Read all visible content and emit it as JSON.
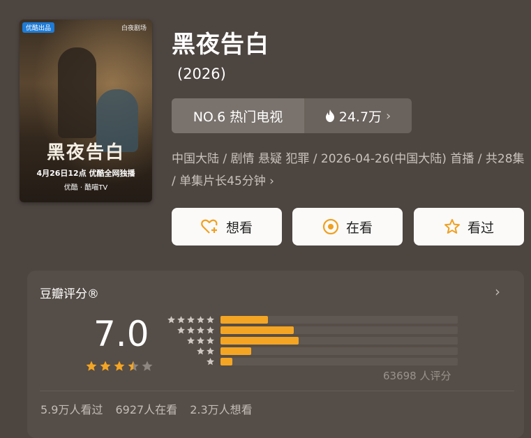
{
  "poster": {
    "badge": "优酷出品",
    "studio": "白夜剧场",
    "title": "黑夜告白",
    "date_line": "4月26日12点 优酷全网独播",
    "platform_line": "优酷 · 酷喵TV"
  },
  "header": {
    "title": "黑夜告白",
    "year": "(2026)"
  },
  "rank": {
    "label": "NO.6 热门电视",
    "heat": "24.7万",
    "heat_icon": "flame-icon",
    "chevron": "›"
  },
  "meta": {
    "text": "中国大陆 / 剧情 悬疑 犯罪 / 2026-04-26(中国大陆) 首播 / 共28集 / 单集片长45分钟 ›"
  },
  "actions": [
    {
      "label": "想看",
      "icon": "heart-plus-icon"
    },
    {
      "label": "在看",
      "icon": "target-icon"
    },
    {
      "label": "看过",
      "icon": "star-icon"
    }
  ],
  "rating": {
    "title": "豆瓣评分®",
    "chevron": "›",
    "score": "7.0",
    "star_fill": 3.5,
    "star_max": 5,
    "distribution": [
      {
        "stars": 5,
        "fraction": 0.2
      },
      {
        "stars": 4,
        "fraction": 0.31
      },
      {
        "stars": 3,
        "fraction": 0.33
      },
      {
        "stars": 2,
        "fraction": 0.13
      },
      {
        "stars": 1,
        "fraction": 0.05
      }
    ],
    "votes": "63698 人评分"
  },
  "stats": {
    "watched": "5.9万人看过",
    "watching": "6927人在看",
    "want": "2.3万人想看"
  },
  "colors": {
    "background": "#4d4540",
    "card": "#554d47",
    "bar_fill": "#f4a523",
    "star_fill": "#f4a523",
    "button_bg": "#fbfaf8",
    "icon_accent": "#f0a020"
  }
}
